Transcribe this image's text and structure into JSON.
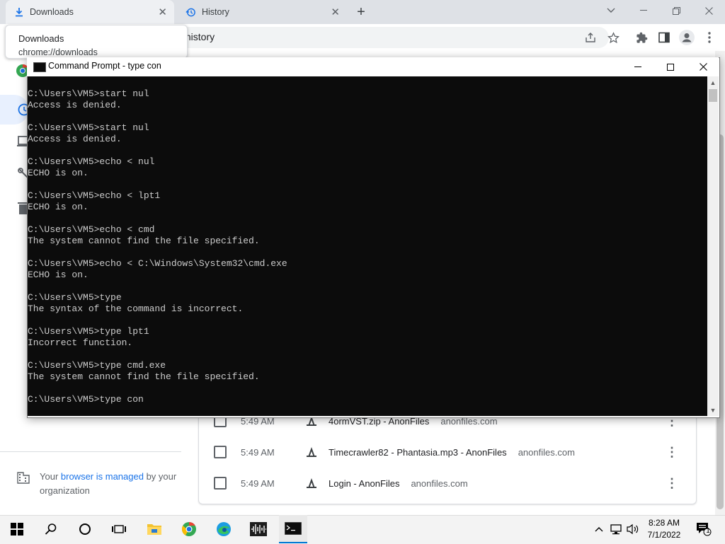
{
  "browser": {
    "tabs": [
      {
        "title": "Downloads",
        "icon": "download-icon"
      },
      {
        "title": "History",
        "icon": "history-icon"
      }
    ],
    "new_tab_label": "+",
    "url": "/history",
    "tooltip": {
      "title": "Downloads",
      "url": "chrome://downloads"
    }
  },
  "history_page": {
    "managed_notice": {
      "prefix": "Your ",
      "link": "browser is managed",
      "suffix": " by your organization"
    },
    "entries": [
      {
        "time": "5:49 AM",
        "title": "4ormVST.zip - AnonFiles",
        "domain": "anonfiles.com"
      },
      {
        "time": "5:49 AM",
        "title": "Timecrawler82 - Phantasia.mp3 - AnonFiles",
        "domain": "anonfiles.com"
      },
      {
        "time": "5:49 AM",
        "title": "Login - AnonFiles",
        "domain": "anonfiles.com"
      }
    ]
  },
  "cmd": {
    "title": "Command Prompt - type  con",
    "lines": [
      "C:\\Users\\VM5>start nul",
      "Access is denied.",
      "",
      "C:\\Users\\VM5>start nul",
      "Access is denied.",
      "",
      "C:\\Users\\VM5>echo < nul",
      "ECHO is on.",
      "",
      "C:\\Users\\VM5>echo < lpt1",
      "ECHO is on.",
      "",
      "C:\\Users\\VM5>echo < cmd",
      "The system cannot find the file specified.",
      "",
      "C:\\Users\\VM5>echo < C:\\Windows\\System32\\cmd.exe",
      "ECHO is on.",
      "",
      "C:\\Users\\VM5>type",
      "The syntax of the command is incorrect.",
      "",
      "C:\\Users\\VM5>type lpt1",
      "Incorrect function.",
      "",
      "C:\\Users\\VM5>type cmd.exe",
      "The system cannot find the file specified.",
      "",
      "C:\\Users\\VM5>type con"
    ]
  },
  "taskbar": {
    "time": "8:28 AM",
    "date": "7/1/2022",
    "notification_count": "1"
  }
}
